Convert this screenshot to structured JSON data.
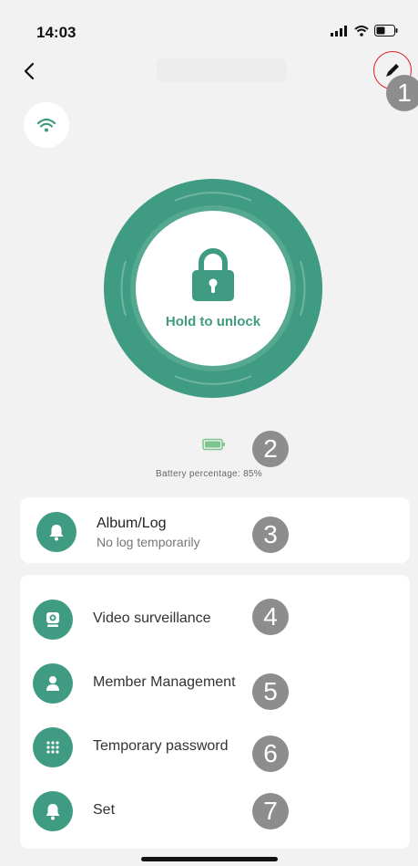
{
  "status_bar": {
    "time": "14:03"
  },
  "lock_control": {
    "label": "Hold to unlock"
  },
  "battery": {
    "text": "Battery percentage: 85%"
  },
  "album": {
    "title": "Album/Log",
    "subtitle": "No log temporarily"
  },
  "menu": {
    "items": [
      {
        "label": "Video surveillance",
        "icon": "camera-icon"
      },
      {
        "label": "Member Management",
        "icon": "person-icon"
      },
      {
        "label": "Temporary password",
        "icon": "keypad-icon"
      },
      {
        "label": "Set",
        "icon": "bell-icon"
      }
    ]
  },
  "markers": [
    "1",
    "2",
    "3",
    "4",
    "5",
    "6",
    "7"
  ],
  "colors": {
    "accent": "#3f9c82",
    "marker": "#8d8d8d",
    "highlight_ring": "#dd2222"
  }
}
